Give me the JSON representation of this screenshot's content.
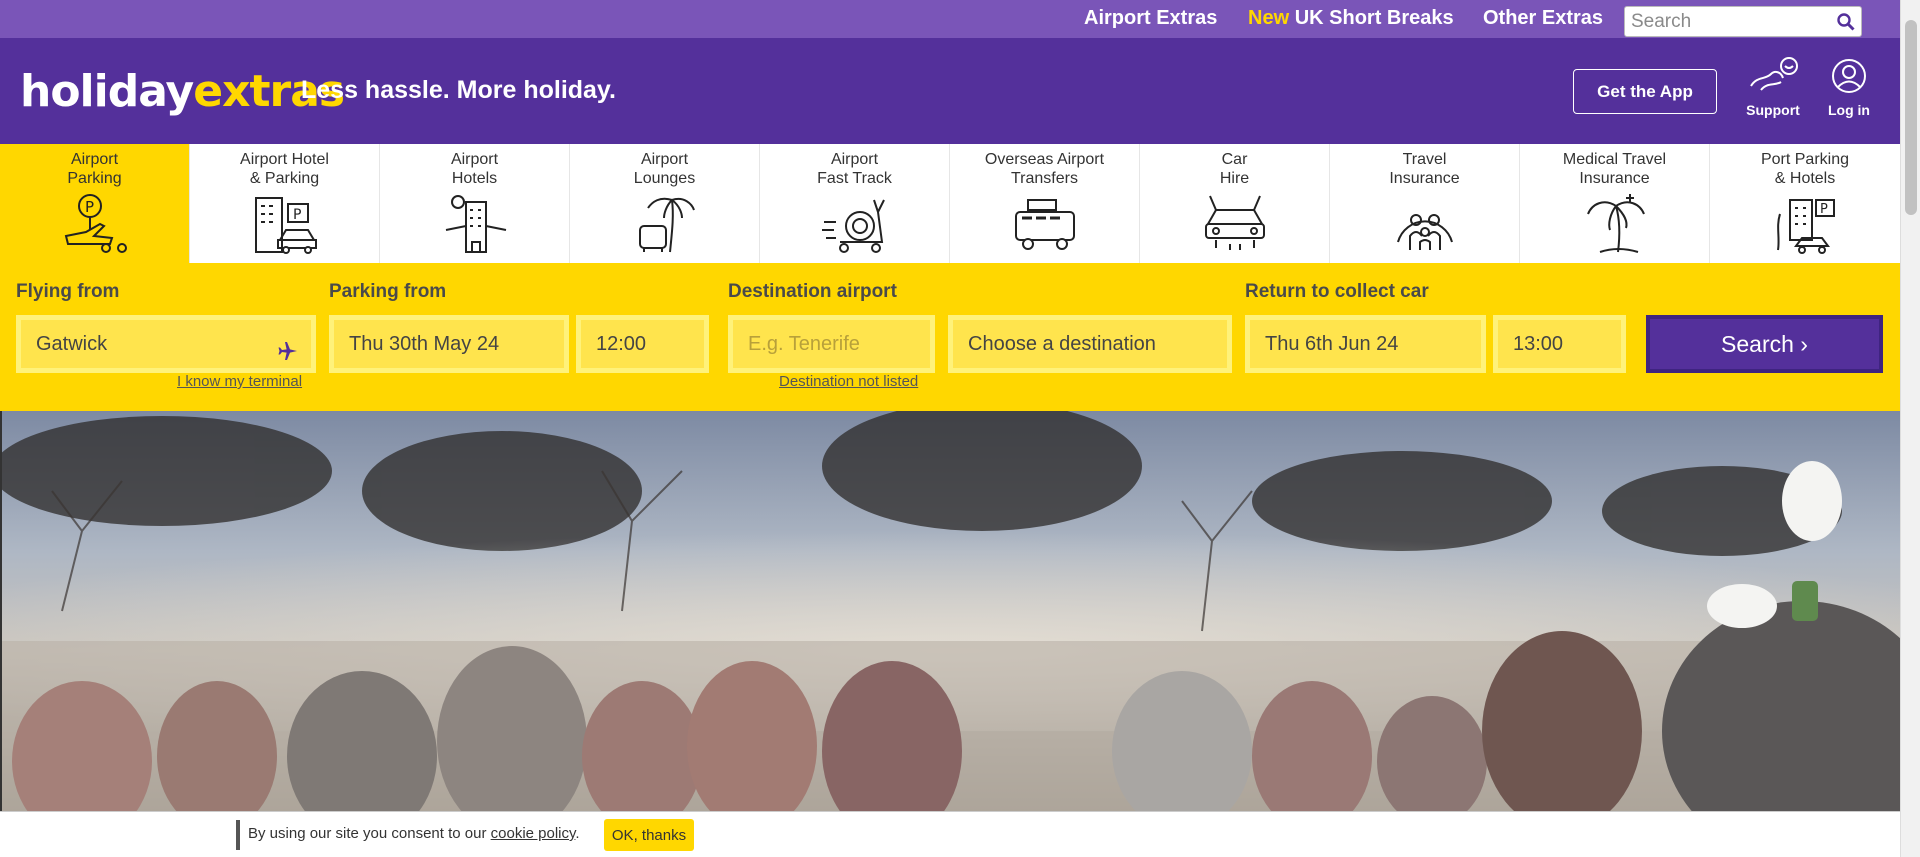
{
  "topnav": {
    "airport_extras": "Airport Extras",
    "short_breaks_new": "New",
    "short_breaks": "UK Short Breaks",
    "other_extras": "Other Extras",
    "search_placeholder": "Search"
  },
  "header": {
    "logo_part1": "holiday",
    "logo_part2": "extras",
    "tagline": "Less hassle. More holiday.",
    "get_app": "Get the App",
    "support": "Support",
    "login": "Log in"
  },
  "categories": [
    {
      "label": "Airport\nParking",
      "icon": "airport-parking-icon"
    },
    {
      "label": "Airport Hotel\n& Parking",
      "icon": "hotel-parking-icon"
    },
    {
      "label": "Airport\nHotels",
      "icon": "airport-hotel-icon"
    },
    {
      "label": "Airport\nLounges",
      "icon": "lounge-icon"
    },
    {
      "label": "Airport\nFast Track",
      "icon": "fast-track-snail-icon"
    },
    {
      "label": "Overseas Airport\nTransfers",
      "icon": "transfer-bus-icon"
    },
    {
      "label": "Car\nHire",
      "icon": "car-hire-icon"
    },
    {
      "label": "Travel\nInsurance",
      "icon": "family-insurance-icon"
    },
    {
      "label": "Medical Travel\nInsurance",
      "icon": "medical-palm-icon"
    },
    {
      "label": "Port Parking\n& Hotels",
      "icon": "port-parking-icon"
    }
  ],
  "form": {
    "flying_from_label": "Flying from",
    "flying_from_value": "Gatwick",
    "know_terminal": "I know my terminal",
    "parking_from_label": "Parking from",
    "parking_date": "Thu 30th May 24",
    "parking_time": "12:00",
    "destination_label": "Destination airport",
    "destination_placeholder": "E.g. Tenerife",
    "destination_choose": "Choose a destination",
    "destination_not_listed": "Destination not listed",
    "return_label": "Return to collect car",
    "return_date": "Thu 6th Jun 24",
    "return_time": "13:00",
    "search": "Search ›"
  },
  "cookie": {
    "text_before": "By using our site you consent to our ",
    "link": "cookie policy",
    "text_after": ".",
    "ok": "OK, thanks"
  },
  "colors": {
    "purple": "#54309b",
    "topbar_purple": "#7a55b8",
    "yellow": "#ffd700"
  }
}
